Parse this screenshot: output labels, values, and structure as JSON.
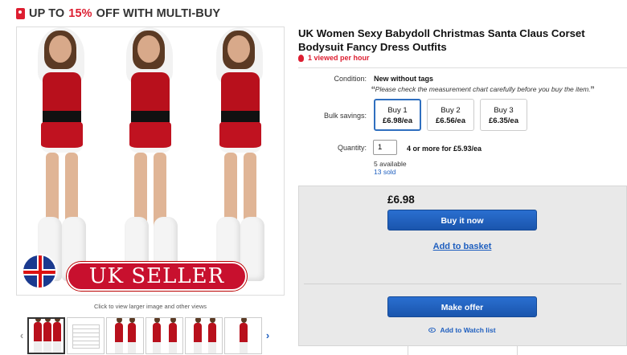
{
  "promo": {
    "prefix": "UP TO ",
    "percent": "15%",
    "suffix": " OFF WITH MULTI-BUY",
    "accent": "#dd1e31"
  },
  "gallery": {
    "overlay_text": "UK SELLER",
    "caption": "Click to view larger image and other views",
    "thumbnail_count": 7
  },
  "listing": {
    "title": "UK Women Sexy Babydoll Christmas Santa Claus Corset Bodysuit Fancy Dress Outfits",
    "viewed": "1 viewed per hour"
  },
  "condition": {
    "label": "Condition:",
    "value": "New without tags",
    "note": "Please check the measurement chart carefully before you buy the item."
  },
  "bulk": {
    "label": "Bulk savings:",
    "options": [
      {
        "label": "Buy 1",
        "price": "£6.98/ea"
      },
      {
        "label": "Buy 2",
        "price": "£6.56/ea"
      },
      {
        "label": "Buy 3",
        "price": "£6.35/ea"
      }
    ],
    "selected_index": 0
  },
  "quantity": {
    "label": "Quantity:",
    "value": "1",
    "offer": "4 or more for £5.93/ea",
    "available": "5 available",
    "sold": "13 sold"
  },
  "buybox": {
    "price": "£6.98",
    "buy_now": "Buy it now",
    "add_basket": "Add to basket",
    "make_offer": "Make offer",
    "watch": "Add to Watch list",
    "button_color": "#1c5cb8",
    "link_color": "#1f5fbf"
  }
}
